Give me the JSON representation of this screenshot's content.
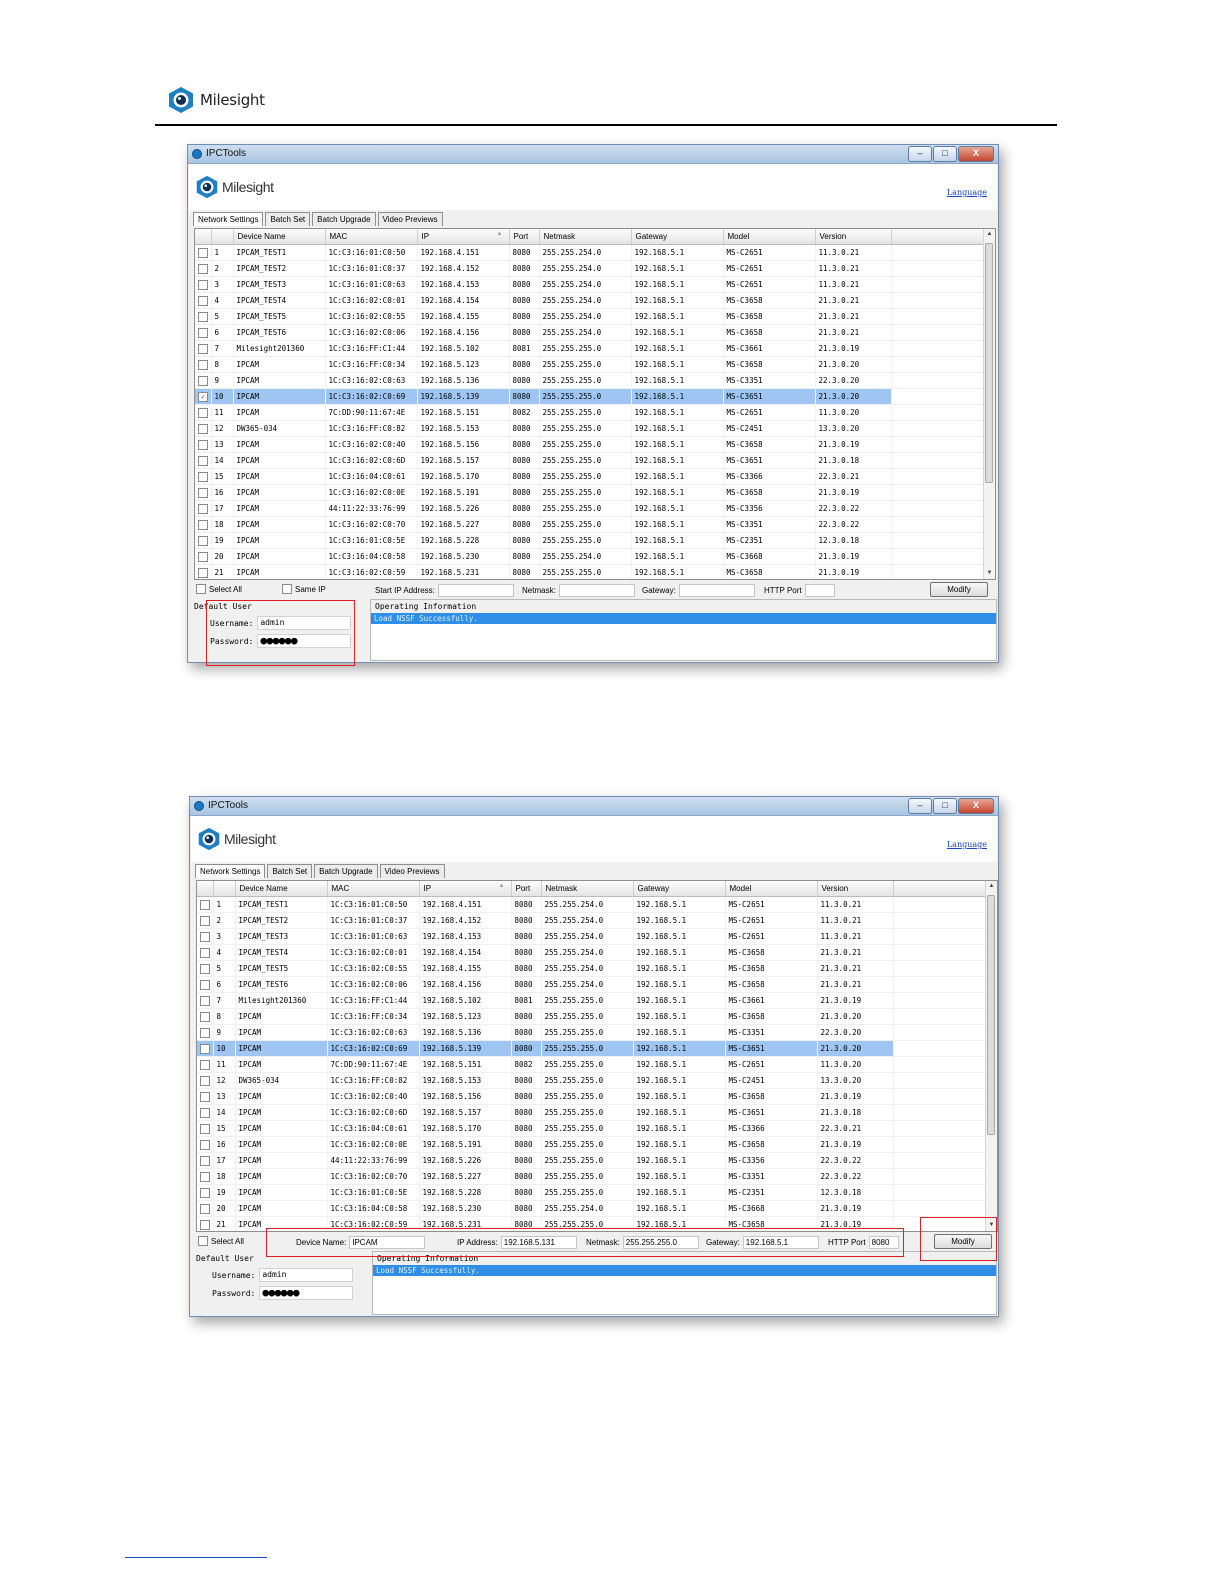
{
  "page_header": {
    "brand": "Milesight"
  },
  "app": {
    "window_title": "IPCTools",
    "app_logo_text": "Milesight",
    "language_link": "Language",
    "tabs": [
      "Network Settings",
      "Batch Set",
      "Batch Upgrade",
      "Video Previews"
    ],
    "columns": [
      "",
      "",
      "Device Name",
      "MAC",
      "IP",
      "Port",
      "Netmask",
      "Gateway",
      "Model",
      "Version"
    ],
    "sort_indicator": "▲",
    "window_buttons": [
      "–",
      "□",
      "X"
    ]
  },
  "devices": [
    {
      "no": "1",
      "name": "IPCAM_TEST1",
      "mac": "1C:C3:16:01:C0:50",
      "ip": "192.168.4.151",
      "port": "8080",
      "mask": "255.255.254.0",
      "gw": "192.168.5.1",
      "model": "MS-C2651",
      "ver": "11.3.0.21"
    },
    {
      "no": "2",
      "name": "IPCAM_TEST2",
      "mac": "1C:C3:16:01:C0:37",
      "ip": "192.168.4.152",
      "port": "8080",
      "mask": "255.255.254.0",
      "gw": "192.168.5.1",
      "model": "MS-C2651",
      "ver": "11.3.0.21"
    },
    {
      "no": "3",
      "name": "IPCAM_TEST3",
      "mac": "1C:C3:16:01:C0:63",
      "ip": "192.168.4.153",
      "port": "8080",
      "mask": "255.255.254.0",
      "gw": "192.168.5.1",
      "model": "MS-C2651",
      "ver": "11.3.0.21"
    },
    {
      "no": "4",
      "name": "IPCAM_TEST4",
      "mac": "1C:C3:16:02:C0:01",
      "ip": "192.168.4.154",
      "port": "8080",
      "mask": "255.255.254.0",
      "gw": "192.168.5.1",
      "model": "MS-C3658",
      "ver": "21.3.0.21"
    },
    {
      "no": "5",
      "name": "IPCAM_TEST5",
      "mac": "1C:C3:16:02:C0:55",
      "ip": "192.168.4.155",
      "port": "8080",
      "mask": "255.255.254.0",
      "gw": "192.168.5.1",
      "model": "MS-C3658",
      "ver": "21.3.0.21"
    },
    {
      "no": "6",
      "name": "IPCAM_TEST6",
      "mac": "1C:C3:16:02:C0:06",
      "ip": "192.168.4.156",
      "port": "8080",
      "mask": "255.255.254.0",
      "gw": "192.168.5.1",
      "model": "MS-C3658",
      "ver": "21.3.0.21"
    },
    {
      "no": "7",
      "name": "Milesight201360",
      "mac": "1C:C3:16:FF:C1:44",
      "ip": "192.168.5.102",
      "port": "8081",
      "mask": "255.255.255.0",
      "gw": "192.168.5.1",
      "model": "MS-C3661",
      "ver": "21.3.0.19"
    },
    {
      "no": "8",
      "name": "IPCAM",
      "mac": "1C:C3:16:FF:C0:34",
      "ip": "192.168.5.123",
      "port": "8080",
      "mask": "255.255.255.0",
      "gw": "192.168.5.1",
      "model": "MS-C3658",
      "ver": "21.3.0.20"
    },
    {
      "no": "9",
      "name": "IPCAM",
      "mac": "1C:C3:16:02:C0:63",
      "ip": "192.168.5.136",
      "port": "8080",
      "mask": "255.255.255.0",
      "gw": "192.168.5.1",
      "model": "MS-C3351",
      "ver": "22.3.0.20"
    },
    {
      "no": "10",
      "name": "IPCAM",
      "mac": "1C:C3:16:02:C0:69",
      "ip": "192.168.5.139",
      "port": "8080",
      "mask": "255.255.255.0",
      "gw": "192.168.5.1",
      "model": "MS-C3651",
      "ver": "21.3.0.20"
    },
    {
      "no": "11",
      "name": "IPCAM",
      "mac": "7C:DD:90:11:67:4E",
      "ip": "192.168.5.151",
      "port": "8082",
      "mask": "255.255.255.0",
      "gw": "192.168.5.1",
      "model": "MS-C2651",
      "ver": "11.3.0.20"
    },
    {
      "no": "12",
      "name": "DW365-034",
      "mac": "1C:C3:16:FF:C0:82",
      "ip": "192.168.5.153",
      "port": "8080",
      "mask": "255.255.255.0",
      "gw": "192.168.5.1",
      "model": "MS-C2451",
      "ver": "13.3.0.20"
    },
    {
      "no": "13",
      "name": "IPCAM",
      "mac": "1C:C3:16:02:C0:40",
      "ip": "192.168.5.156",
      "port": "8080",
      "mask": "255.255.255.0",
      "gw": "192.168.5.1",
      "model": "MS-C3658",
      "ver": "21.3.0.19"
    },
    {
      "no": "14",
      "name": "IPCAM",
      "mac": "1C:C3:16:02:C0:6D",
      "ip": "192.168.5.157",
      "port": "8080",
      "mask": "255.255.255.0",
      "gw": "192.168.5.1",
      "model": "MS-C3651",
      "ver": "21.3.0.18"
    },
    {
      "no": "15",
      "name": "IPCAM",
      "mac": "1C:C3:16:04:C0:61",
      "ip": "192.168.5.170",
      "port": "8080",
      "mask": "255.255.255.0",
      "gw": "192.168.5.1",
      "model": "MS-C3366",
      "ver": "22.3.0.21"
    },
    {
      "no": "16",
      "name": "IPCAM",
      "mac": "1C:C3:16:02:C0:0E",
      "ip": "192.168.5.191",
      "port": "8080",
      "mask": "255.255.255.0",
      "gw": "192.168.5.1",
      "model": "MS-C3658",
      "ver": "21.3.0.19"
    },
    {
      "no": "17",
      "name": "IPCAM",
      "mac": "44:11:22:33:76:99",
      "ip": "192.168.5.226",
      "port": "8080",
      "mask": "255.255.255.0",
      "gw": "192.168.5.1",
      "model": "MS-C3356",
      "ver": "22.3.0.22"
    },
    {
      "no": "18",
      "name": "IPCAM",
      "mac": "1C:C3:16:02:C0:70",
      "ip": "192.168.5.227",
      "port": "8080",
      "mask": "255.255.255.0",
      "gw": "192.168.5.1",
      "model": "MS-C3351",
      "ver": "22.3.0.22"
    },
    {
      "no": "19",
      "name": "IPCAM",
      "mac": "1C:C3:16:01:C0:5E",
      "ip": "192.168.5.228",
      "port": "8080",
      "mask": "255.255.255.0",
      "gw": "192.168.5.1",
      "model": "MS-C2351",
      "ver": "12.3.0.18"
    },
    {
      "no": "20",
      "name": "IPCAM",
      "mac": "1C:C3:16:04:C0:58",
      "ip": "192.168.5.230",
      "port": "8080",
      "mask": "255.255.254.0",
      "gw": "192.168.5.1",
      "model": "MS-C3668",
      "ver": "21.3.0.19"
    },
    {
      "no": "21",
      "name": "IPCAM",
      "mac": "1C:C3:16:02:C0:59",
      "ip": "192.168.5.231",
      "port": "8080",
      "mask": "255.255.255.0",
      "gw": "192.168.5.1",
      "model": "MS-C3658",
      "ver": "21.3.0.19"
    }
  ],
  "selected_row": 10,
  "screens": [
    {
      "selected_checked": true,
      "toolbar": {
        "select_all": "Select All",
        "same_ip": "Same IP",
        "start_ip_label": "Start IP Address:",
        "start_ip_value": "",
        "netmask_label": "Netmask:",
        "netmask_value": "",
        "gateway_label": "Gateway:",
        "gateway_value": "",
        "http_port_label": "HTTP Port",
        "http_port_value": "",
        "modify": "Modify"
      }
    },
    {
      "selected_checked": false,
      "toolbar": {
        "select_all": "Select All",
        "device_name_label": "Device Name:",
        "device_name_value": "IPCAM",
        "ip_label": "IP Address:",
        "ip_value": "192.168.5.131",
        "netmask_label": "Netmask:",
        "netmask_value": "255.255.255.0",
        "gateway_label": "Gateway:",
        "gateway_value": "192.168.5.1",
        "http_port_label": "HTTP Port",
        "http_port_value": "8080",
        "modify": "Modify"
      }
    }
  ],
  "default_user": {
    "title": "Default User",
    "username_label": "Username:",
    "username_value": "admin",
    "password_label": "Password:",
    "password_value": "●●●●●●"
  },
  "operating_info": {
    "title": "Operating Information",
    "message": "Load NSSF Successfully."
  },
  "colors": {
    "highlight": "#e02020",
    "selected_row": "#9fc6f2",
    "link": "#1a44c4"
  }
}
